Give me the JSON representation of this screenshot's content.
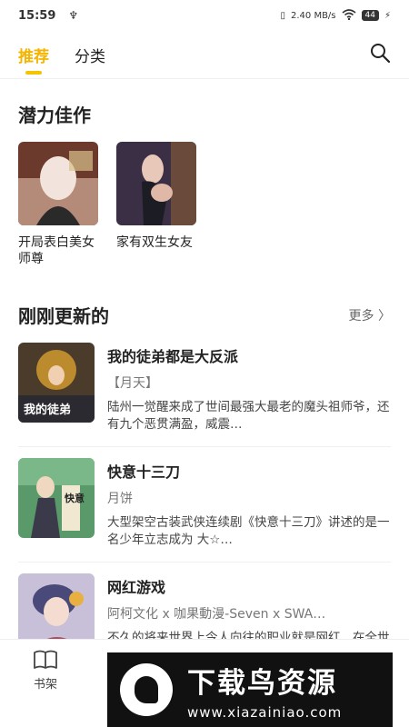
{
  "status": {
    "time": "15:59",
    "usb": "♆",
    "speed": "2.40 MB/s",
    "battery": "44"
  },
  "nav": {
    "tab_recommend": "推荐",
    "tab_category": "分类"
  },
  "potential": {
    "title": "潜力佳作",
    "items": [
      {
        "title": "开局表白美女师尊"
      },
      {
        "title": "家有双生女友"
      }
    ]
  },
  "recent": {
    "title": "刚刚更新的",
    "more": "更多",
    "items": [
      {
        "name": "我的徒弟都是大反派",
        "author": "【月天】",
        "desc": "陆州一觉醒来成了世间最强大最老的魔头祖师爷，还有九个恶贯满盈，威震…"
      },
      {
        "name": "快意十三刀",
        "author": "月饼",
        "desc": "大型架空古装武侠连续剧《快意十三刀》讲述的是一名少年立志成为 大☆…"
      },
      {
        "name": "网红游戏",
        "author": "阿柯文化 x 咖果動漫-Seven x SWA…",
        "desc": "不久的将来世界上令人向往的职业就是网红，在全世界国家重点扶植的的赛…"
      }
    ]
  },
  "bottom": {
    "shelf": "书架"
  },
  "watermark": {
    "title": "下载鸟资源",
    "url": "www.xiazainiao.com"
  }
}
